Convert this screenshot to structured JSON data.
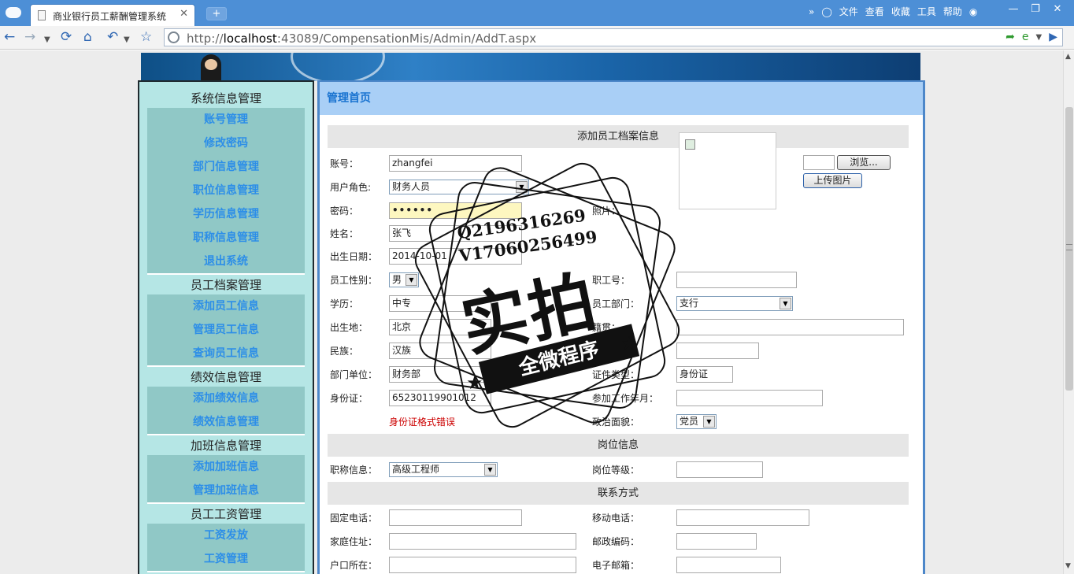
{
  "browser": {
    "tab_title": "商业银行员工薪酬管理系统",
    "tab_close": "✕",
    "new_tab": "+",
    "url_prefix": "http://",
    "url_host": "localhost",
    "url_rest": ":43089/CompensationMis/Admin/AddT.aspx",
    "menu": [
      "»",
      "文件",
      "查看",
      "收藏",
      "工具",
      "帮助"
    ]
  },
  "sidebar": {
    "sections": [
      {
        "title": "系统信息管理",
        "items": [
          "账号管理",
          "修改密码",
          "部门信息管理",
          "职位信息管理",
          "学历信息管理",
          "职称信息管理",
          "退出系统"
        ]
      },
      {
        "title": "员工档案管理",
        "items": [
          "添加员工信息",
          "管理员工信息",
          "查询员工信息"
        ]
      },
      {
        "title": "绩效信息管理",
        "items": [
          "添加绩效信息",
          "绩效信息管理"
        ]
      },
      {
        "title": "加班信息管理",
        "items": [
          "添加加班信息",
          "管理加班信息"
        ]
      },
      {
        "title": "员工工资管理",
        "items": [
          "工资发放",
          "工资管理"
        ]
      }
    ]
  },
  "main": {
    "header": "管理首页",
    "form": {
      "section_title": "添加员工档案信息",
      "account_label": "账号：",
      "account_value": "zhangfei",
      "role_label": "用户角色:",
      "role_value": "财务人员",
      "password_label": "密码：",
      "password_value": "••••••",
      "name_label": "姓名：",
      "name_value": "张飞",
      "birth_label": "出生日期：",
      "birth_value": "2014-10-01",
      "gender_label": "员工性别：",
      "gender_value": "男",
      "education_label": "学历：",
      "education_value": "中专",
      "birthplace_label": "出生地：",
      "birthplace_value": "北京",
      "ethnicity_label": "民族：",
      "ethnicity_value": "汉族",
      "dept_label": "部门单位：",
      "dept_value": "财务部",
      "idcard_label": "身份证：",
      "idcard_value": "65230119901012",
      "idcard_error": "身份证格式错误",
      "photo_label": "照片：",
      "browse_button": "浏览...",
      "upload_button": "上传图片",
      "empno_label": "职工号：",
      "empdept_label": "员工部门：",
      "empdept_value": "支行",
      "native_label": "籍贯：",
      "blank_label": "：",
      "idtype_label": "证件类型：",
      "idtype_value": "身份证",
      "workstart_label": "参加工作年月：",
      "political_label": "政治面貌：",
      "political_value": "党员",
      "position_section": "岗位信息",
      "title_label": "职称信息：",
      "title_value": "高级工程师",
      "level_label": "岗位等级：",
      "contact_section": "联系方式",
      "phone_label": "固定电话：",
      "mobile_label": "移动电话：",
      "address_label": "家庭住址：",
      "postcode_label": "邮政编码：",
      "hukou_label": "户口所在：",
      "email_label": "电子邮箱："
    }
  },
  "watermark": {
    "line1": "Q2196316269",
    "line2": "V17060256499",
    "big": "实拍",
    "ribbon": "全微程序"
  }
}
